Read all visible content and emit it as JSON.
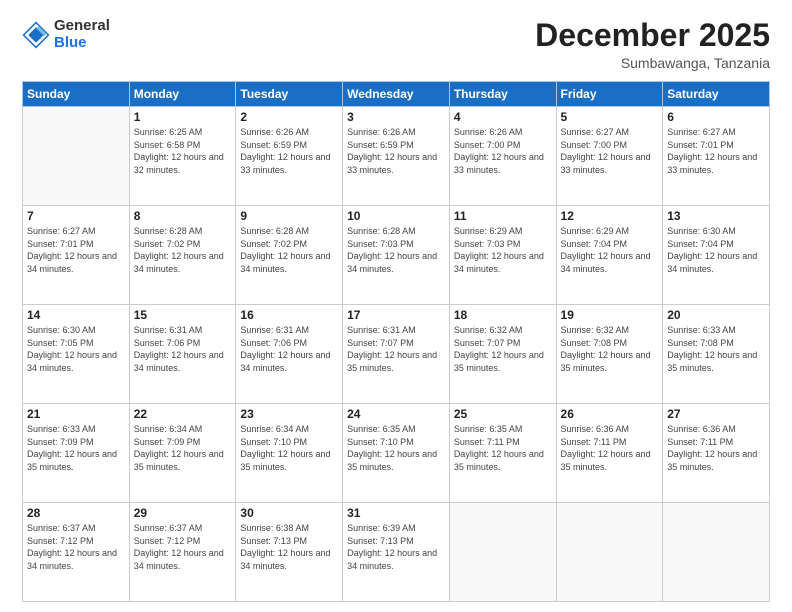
{
  "logo": {
    "text_general": "General",
    "text_blue": "Blue"
  },
  "header": {
    "month": "December 2025",
    "location": "Sumbawanga, Tanzania"
  },
  "weekdays": [
    "Sunday",
    "Monday",
    "Tuesday",
    "Wednesday",
    "Thursday",
    "Friday",
    "Saturday"
  ],
  "weeks": [
    [
      {
        "day": "",
        "empty": true
      },
      {
        "day": "1",
        "sunrise": "6:25 AM",
        "sunset": "6:58 PM",
        "daylight": "12 hours and 32 minutes."
      },
      {
        "day": "2",
        "sunrise": "6:26 AM",
        "sunset": "6:59 PM",
        "daylight": "12 hours and 33 minutes."
      },
      {
        "day": "3",
        "sunrise": "6:26 AM",
        "sunset": "6:59 PM",
        "daylight": "12 hours and 33 minutes."
      },
      {
        "day": "4",
        "sunrise": "6:26 AM",
        "sunset": "7:00 PM",
        "daylight": "12 hours and 33 minutes."
      },
      {
        "day": "5",
        "sunrise": "6:27 AM",
        "sunset": "7:00 PM",
        "daylight": "12 hours and 33 minutes."
      },
      {
        "day": "6",
        "sunrise": "6:27 AM",
        "sunset": "7:01 PM",
        "daylight": "12 hours and 33 minutes."
      }
    ],
    [
      {
        "day": "7",
        "sunrise": "6:27 AM",
        "sunset": "7:01 PM",
        "daylight": "12 hours and 34 minutes."
      },
      {
        "day": "8",
        "sunrise": "6:28 AM",
        "sunset": "7:02 PM",
        "daylight": "12 hours and 34 minutes."
      },
      {
        "day": "9",
        "sunrise": "6:28 AM",
        "sunset": "7:02 PM",
        "daylight": "12 hours and 34 minutes."
      },
      {
        "day": "10",
        "sunrise": "6:28 AM",
        "sunset": "7:03 PM",
        "daylight": "12 hours and 34 minutes."
      },
      {
        "day": "11",
        "sunrise": "6:29 AM",
        "sunset": "7:03 PM",
        "daylight": "12 hours and 34 minutes."
      },
      {
        "day": "12",
        "sunrise": "6:29 AM",
        "sunset": "7:04 PM",
        "daylight": "12 hours and 34 minutes."
      },
      {
        "day": "13",
        "sunrise": "6:30 AM",
        "sunset": "7:04 PM",
        "daylight": "12 hours and 34 minutes."
      }
    ],
    [
      {
        "day": "14",
        "sunrise": "6:30 AM",
        "sunset": "7:05 PM",
        "daylight": "12 hours and 34 minutes."
      },
      {
        "day": "15",
        "sunrise": "6:31 AM",
        "sunset": "7:06 PM",
        "daylight": "12 hours and 34 minutes."
      },
      {
        "day": "16",
        "sunrise": "6:31 AM",
        "sunset": "7:06 PM",
        "daylight": "12 hours and 34 minutes."
      },
      {
        "day": "17",
        "sunrise": "6:31 AM",
        "sunset": "7:07 PM",
        "daylight": "12 hours and 35 minutes."
      },
      {
        "day": "18",
        "sunrise": "6:32 AM",
        "sunset": "7:07 PM",
        "daylight": "12 hours and 35 minutes."
      },
      {
        "day": "19",
        "sunrise": "6:32 AM",
        "sunset": "7:08 PM",
        "daylight": "12 hours and 35 minutes."
      },
      {
        "day": "20",
        "sunrise": "6:33 AM",
        "sunset": "7:08 PM",
        "daylight": "12 hours and 35 minutes."
      }
    ],
    [
      {
        "day": "21",
        "sunrise": "6:33 AM",
        "sunset": "7:09 PM",
        "daylight": "12 hours and 35 minutes."
      },
      {
        "day": "22",
        "sunrise": "6:34 AM",
        "sunset": "7:09 PM",
        "daylight": "12 hours and 35 minutes."
      },
      {
        "day": "23",
        "sunrise": "6:34 AM",
        "sunset": "7:10 PM",
        "daylight": "12 hours and 35 minutes."
      },
      {
        "day": "24",
        "sunrise": "6:35 AM",
        "sunset": "7:10 PM",
        "daylight": "12 hours and 35 minutes."
      },
      {
        "day": "25",
        "sunrise": "6:35 AM",
        "sunset": "7:11 PM",
        "daylight": "12 hours and 35 minutes."
      },
      {
        "day": "26",
        "sunrise": "6:36 AM",
        "sunset": "7:11 PM",
        "daylight": "12 hours and 35 minutes."
      },
      {
        "day": "27",
        "sunrise": "6:36 AM",
        "sunset": "7:11 PM",
        "daylight": "12 hours and 35 minutes."
      }
    ],
    [
      {
        "day": "28",
        "sunrise": "6:37 AM",
        "sunset": "7:12 PM",
        "daylight": "12 hours and 34 minutes."
      },
      {
        "day": "29",
        "sunrise": "6:37 AM",
        "sunset": "7:12 PM",
        "daylight": "12 hours and 34 minutes."
      },
      {
        "day": "30",
        "sunrise": "6:38 AM",
        "sunset": "7:13 PM",
        "daylight": "12 hours and 34 minutes."
      },
      {
        "day": "31",
        "sunrise": "6:39 AM",
        "sunset": "7:13 PM",
        "daylight": "12 hours and 34 minutes."
      },
      {
        "day": "",
        "empty": true
      },
      {
        "day": "",
        "empty": true
      },
      {
        "day": "",
        "empty": true
      }
    ]
  ]
}
